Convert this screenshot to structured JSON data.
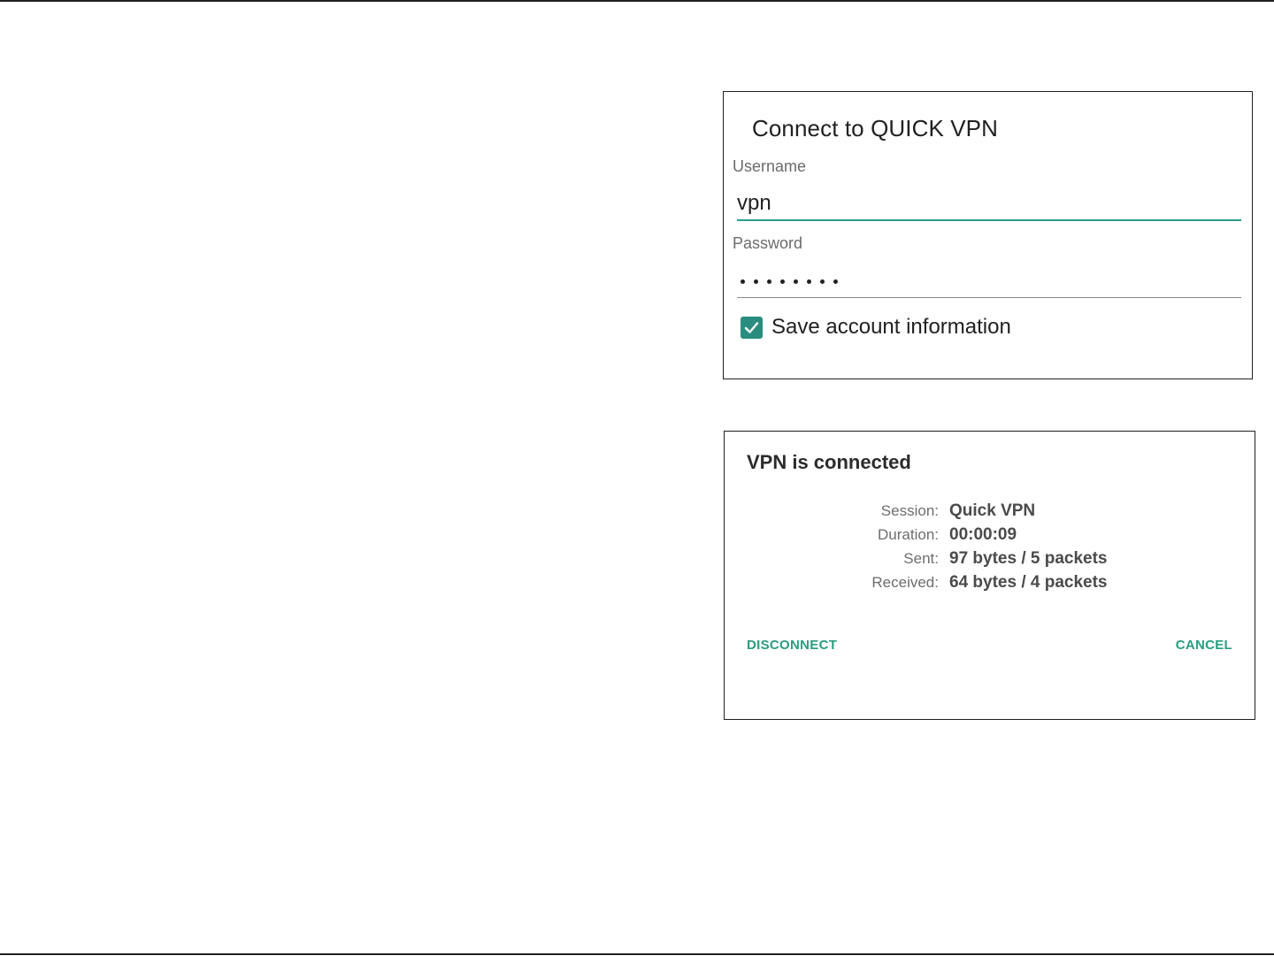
{
  "login_dialog": {
    "title": "Connect to QUICK VPN",
    "username_label": "Username",
    "username_value": "vpn",
    "password_label": "Password",
    "password_masked_length": 8,
    "save_account_label": "Save account information",
    "save_account_checked": true
  },
  "status_dialog": {
    "title": "VPN is connected",
    "stats": [
      {
        "label": "Session:",
        "value": "Quick VPN"
      },
      {
        "label": "Duration:",
        "value": "00:00:09"
      },
      {
        "label": "Sent:",
        "value": "97 bytes / 5 packets"
      },
      {
        "label": "Received:",
        "value": "64 bytes / 4 packets"
      }
    ],
    "disconnect_label": "DISCONNECT",
    "cancel_label": "CANCEL"
  },
  "colors": {
    "accent": "#2a9d8f",
    "checkbox": "#2a8d80",
    "border": "#231f20"
  },
  "icons": {
    "checkbox": "check-icon"
  }
}
